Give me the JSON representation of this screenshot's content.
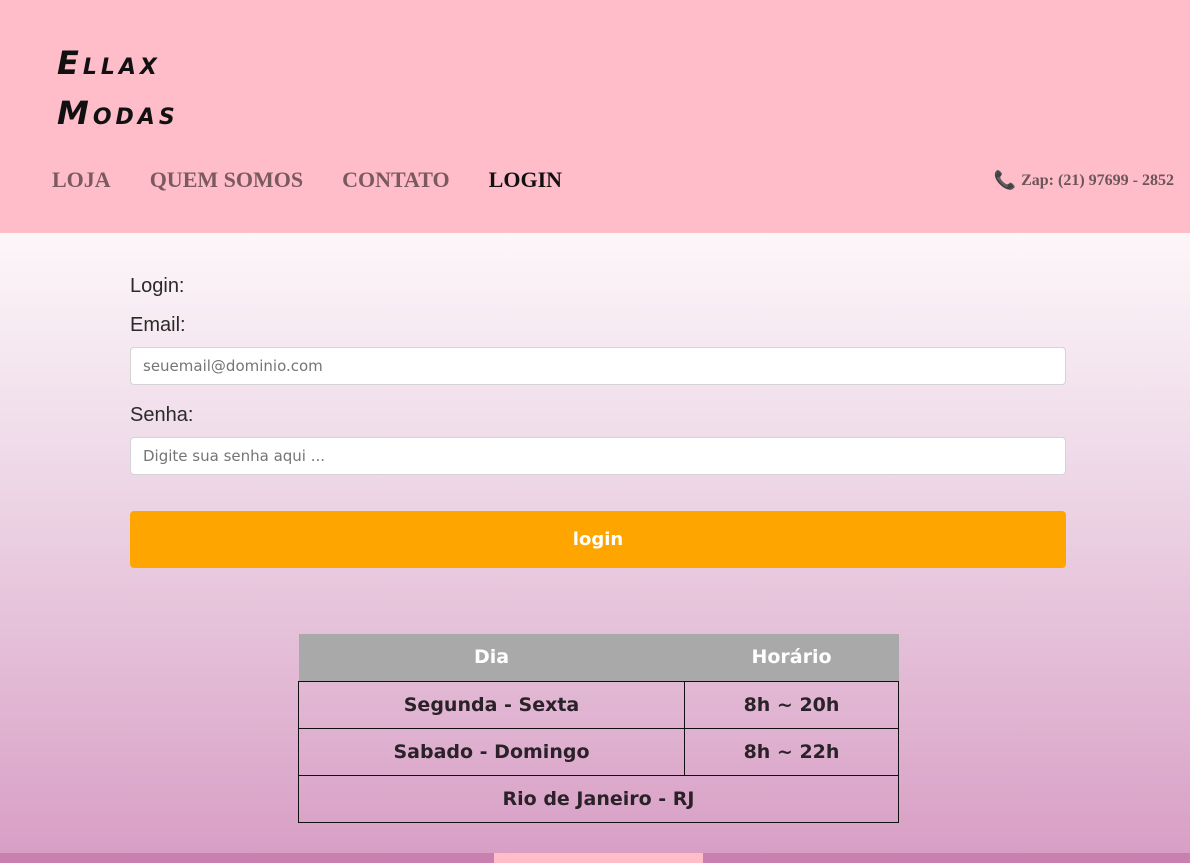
{
  "header": {
    "logo_line1": "Ellax",
    "logo_line2": "Modas",
    "nav": [
      "LOJA",
      "QUEM SOMOS",
      "CONTATO",
      "LOGIN"
    ],
    "active_nav": "LOGIN",
    "phone_icon": "phone-icon",
    "zap": "Zap: (21) 97699 - 2852",
    "bg_color": "#ffbdca"
  },
  "form": {
    "title": "Login:",
    "email_label": "Email:",
    "email_placeholder": "seuemail@dominio.com",
    "password_label": "Senha:",
    "password_placeholder": "Digite sua senha aqui ...",
    "button_label": "login",
    "button_color": "#ffa500"
  },
  "schedule": {
    "headers": [
      "Dia",
      "Horário"
    ],
    "rows": [
      [
        "Segunda - Sexta",
        "8h ~ 20h"
      ],
      [
        "Sabado - Domingo",
        "8h ~ 22h"
      ]
    ],
    "footer_row": "Rio de Janeiro - RJ"
  }
}
